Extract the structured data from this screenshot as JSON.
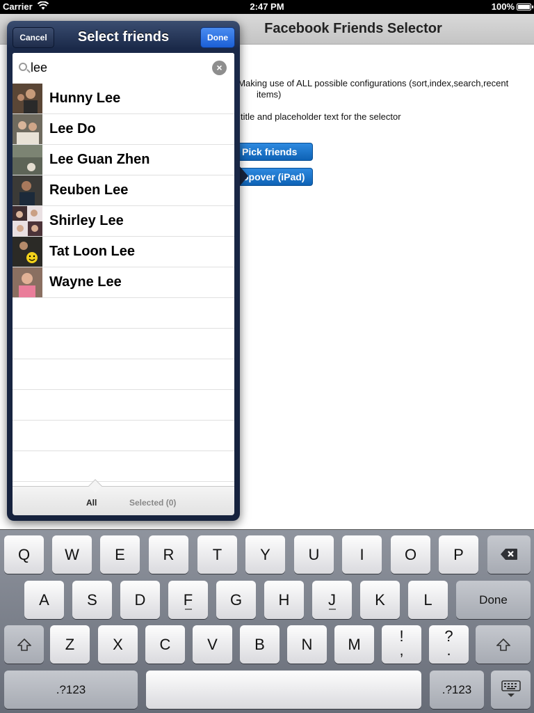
{
  "status_bar": {
    "carrier": "Carrier",
    "time": "2:47 PM",
    "battery": "100%"
  },
  "background": {
    "title": "Facebook Friends Selector",
    "line1": ". Making use of ALL possible configurations (sort,index,search,recent",
    "line1b": "items)",
    "line2": "title and placeholder text for the selector",
    "button1": "Pick friends",
    "button2": "opover (iPad)"
  },
  "popover": {
    "title": "Select friends",
    "cancel": "Cancel",
    "done": "Done",
    "search_value": "lee",
    "clear_symbol": "×",
    "friends": [
      {
        "name": "Hunny Lee"
      },
      {
        "name": "Lee Do"
      },
      {
        "name": "Lee Guan Zhen"
      },
      {
        "name": "Reuben Lee"
      },
      {
        "name": "Shirley Lee"
      },
      {
        "name": "Tat Loon Lee"
      },
      {
        "name": "Wayne Lee"
      }
    ],
    "tabs": {
      "all": "All",
      "selected": "Selected (0)"
    }
  },
  "keyboard": {
    "row1": [
      "Q",
      "W",
      "E",
      "R",
      "T",
      "Y",
      "U",
      "I",
      "O",
      "P"
    ],
    "row2": [
      "A",
      "S",
      "D",
      "F",
      "G",
      "H",
      "J",
      "K",
      "L"
    ],
    "row3": [
      "Z",
      "X",
      "C",
      "V",
      "B",
      "N",
      "M"
    ],
    "done": "Done",
    "num": ".?123",
    "excl_top": "!",
    "excl_bottom": ",",
    "q_top": "?",
    "q_bottom": "."
  },
  "colors": {
    "accent": "#1b5fd6",
    "popover": "#1a2949"
  }
}
